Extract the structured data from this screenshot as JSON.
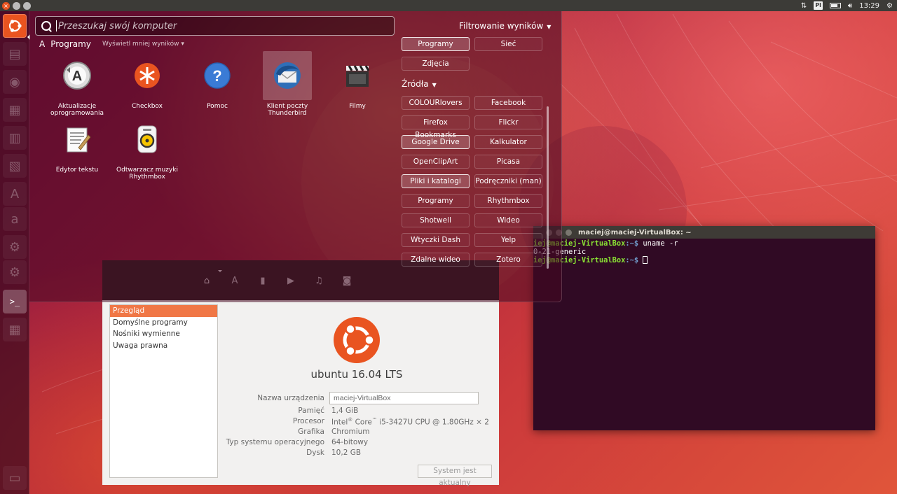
{
  "top_panel": {
    "keyboard_layout": "Pl",
    "time": "13:29"
  },
  "launcher": {
    "items": [
      "dash-home",
      "files",
      "firefox",
      "writer",
      "calc",
      "impress",
      "software-center",
      "amazon",
      "system-settings",
      "terminal",
      "workspaces"
    ]
  },
  "dash": {
    "search_placeholder": "Przeszukaj swój komputer",
    "category": {
      "title": "Programy",
      "more_label": "Wyświetl mniej wyników"
    },
    "apps": [
      {
        "label": "Aktualizacje oprogramowania",
        "icon": "software-updater-icon"
      },
      {
        "label": "Checkbox",
        "icon": "checkbox-icon"
      },
      {
        "label": "Pomoc",
        "icon": "help-icon"
      },
      {
        "label": "Klient poczty Thunderbird",
        "icon": "thunderbird-icon"
      },
      {
        "label": "Filmy",
        "icon": "videos-icon"
      },
      {
        "label": "Edytor tekstu",
        "icon": "text-editor-icon"
      },
      {
        "label": "Odtwarzacz muzyki Rhythmbox",
        "icon": "rhythmbox-icon"
      }
    ],
    "filter_title": "Filtrowanie wyników",
    "type_filters": [
      {
        "label": "Programy",
        "active": true
      },
      {
        "label": "Sieć",
        "active": false
      },
      {
        "label": "Zdjęcia",
        "active": false
      }
    ],
    "sources_title": "Źródła",
    "sources": [
      {
        "label": "COLOURlovers",
        "active": false
      },
      {
        "label": "Facebook",
        "active": false
      },
      {
        "label": "Firefox Bookmarks",
        "active": false
      },
      {
        "label": "Flickr",
        "active": false
      },
      {
        "label": "Google Drive",
        "active": true
      },
      {
        "label": "Kalkulator",
        "active": false
      },
      {
        "label": "OpenClipArt",
        "active": false
      },
      {
        "label": "Picasa",
        "active": false
      },
      {
        "label": "Pliki i katalogi",
        "active": true
      },
      {
        "label": "Podręczniki (man)",
        "active": false
      },
      {
        "label": "Programy",
        "active": false
      },
      {
        "label": "Rhythmbox",
        "active": false
      },
      {
        "label": "Shotwell",
        "active": false
      },
      {
        "label": "Wideo",
        "active": false
      },
      {
        "label": "Wtyczki Dash",
        "active": false
      },
      {
        "label": "Yelp",
        "active": false
      },
      {
        "label": "Zdalne wideo",
        "active": false
      },
      {
        "label": "Zotero",
        "active": false
      }
    ]
  },
  "terminal": {
    "title": "maciej@maciej-VirtualBox: ~",
    "lines": [
      {
        "user": "iej@maciej-VirtualBox",
        "path": ":~$",
        "cmd": " uname -r"
      },
      {
        "output": "0-21-generic"
      },
      {
        "user": "iej@maciej-VirtualBox",
        "path": ":~$",
        "cmd": " "
      }
    ]
  },
  "system_details": {
    "tab_icons": [
      "home-icon",
      "software-icon",
      "document-icon",
      "video-icon",
      "music-icon",
      "camera-icon"
    ],
    "sidebar": [
      {
        "label": "Przegląd",
        "active": true
      },
      {
        "label": "Domyślne programy",
        "active": false
      },
      {
        "label": "Nośniki wymienne",
        "active": false
      },
      {
        "label": "Uwaga prawna",
        "active": false
      }
    ],
    "distro": "ubuntu 16.04 LTS",
    "device_name_label": "Nazwa urządzenia",
    "device_name_value": "maciej-VirtualBox",
    "memory_label": "Pamięć",
    "memory_value": "1,4 GiB",
    "processor_label": "Procesor",
    "processor_value_a": "Intel",
    "processor_value_b": " Core",
    "processor_value_c": " i5-3427U CPU @ 1.80GHz × 2",
    "graphics_label": "Grafika",
    "graphics_value": "Chromium",
    "os_type_label": "Typ systemu operacyjnego",
    "os_type_value": "64-bitowy",
    "disk_label": "Dysk",
    "disk_value": "10,2 GB",
    "update_button": "System jest aktualny"
  },
  "colors": {
    "accent": "#e95420",
    "terminal_bg": "#300a24",
    "panel_bg": "#3c3b37"
  }
}
